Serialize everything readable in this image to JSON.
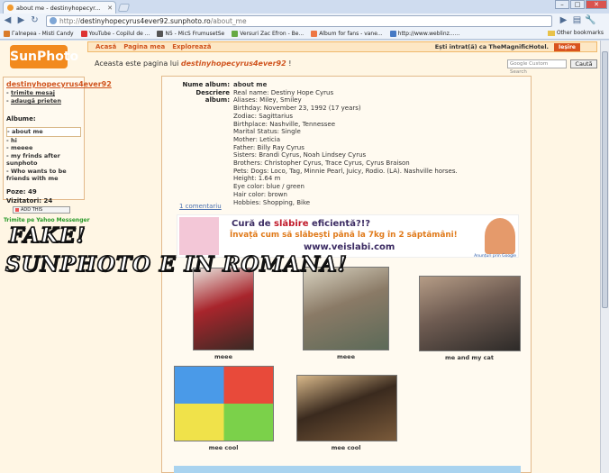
{
  "browser": {
    "tab_title": "about me - destinyhopecyr...",
    "url_prefix": "http://",
    "url_host": "destinyhopecyrus4ever92.sunphoto.ro",
    "url_path": "/about_me",
    "other_bookmarks": "Other bookmarks",
    "bookmarks": [
      {
        "label": "Гalnepea - Misti Candy",
        "color": "#d97b2a"
      },
      {
        "label": "YouTube - Copilul de ...",
        "color": "#d33"
      },
      {
        "label": "N5 - MicS FrumusetSe",
        "color": "#555"
      },
      {
        "label": "Versuri Zac Efron - Be...",
        "color": "#6a4"
      },
      {
        "label": "Album for fans - vane...",
        "color": "#e74"
      },
      {
        "label": "http://www.weblinz......",
        "color": "#4679c4"
      }
    ]
  },
  "site": {
    "logo": "SunPhoto",
    "nav": [
      "Acasă",
      "Pagina mea",
      "Explorează"
    ],
    "logged_in_text": "Ești intrat(ă) ca TheMagnificHotel.",
    "logout_label": "Ieșire",
    "page_intro": "Aceasta este pagina lui",
    "page_owner": "destinyhopecyrus4ever92",
    "page_suffix": " !",
    "search_placeholder": "Google Custom Search",
    "search_button": "Caută"
  },
  "sidebar": {
    "username": "destinyhopecyrus4ever92",
    "send_message": "trimite mesaj",
    "add_friend": "adaugă prieten",
    "albums_heading": "Albume:",
    "albums": [
      "about me",
      "hi",
      "meeee",
      "my frinds after sunphoto",
      "Who wants to be friends with me"
    ],
    "photos_label": "Poze:",
    "photos_count": "49",
    "visitors_label": "Vizitatori:",
    "visitors_count": "24",
    "addthis": "ADD THIS",
    "yahoo": "Trimite pe Yahoo Messenger"
  },
  "overlay": {
    "line1": "FAKE!",
    "line2": "SUNPHOTO E IN ROMANA!"
  },
  "album": {
    "name_label": "Nume album:",
    "name_value": "about me",
    "desc_label": "Descriere album:",
    "desc_lines": [
      "Real name: Destiny Hope Cyrus",
      "Aliases: Miley, Smiley",
      "Birthday: November 23, 1992 (17 years)",
      "Zodiac: Sagittarius",
      "Birthplace: Nashville, Tennessee",
      "Marital Status: Single",
      "Mother: Leticia",
      "Father: Billy Ray Cyrus",
      "Sisters: Brandi Cyrus, Noah Lindsey Cyrus",
      "Brothers: Christopher Cyrus, Trace Cyrus, Cyrus Braison",
      "Pets: Dogs: Loco, Tag, Minnie Pearl, Juicy, Rodio. (LA). Nashville horses.",
      "Height: 1.64 m",
      "Eye color: blue / green",
      "Hair color: brown",
      "Hobbies: Shopping, Bike"
    ],
    "comments": "1 comentariu"
  },
  "ad": {
    "line1_a": "Cură de ",
    "line1_b": "slăbire",
    "line1_c": " eficientă?!?",
    "line2": "Învață cum să slăbești până la 7kg în 2 săptămâni!",
    "line3": "www.veislabi.com",
    "google": "Anunțuri prin Google"
  },
  "photos": [
    {
      "caption": "meee",
      "colors": [
        "#3a2a24",
        "#e8e2dc",
        "#a8252c"
      ]
    },
    {
      "caption": "meee",
      "colors": [
        "#5c6a58",
        "#d8d2c0",
        "#8a7a66"
      ]
    },
    {
      "caption": "me and my cat",
      "colors": [
        "#2d2a28",
        "#b59c86",
        "#6f5c52"
      ]
    },
    {
      "caption": "mee cool",
      "colors": [
        "#e84a3a",
        "#7bd14a",
        "#f0e24a"
      ]
    },
    {
      "caption": "mee cool",
      "colors": [
        "#7a5a3a",
        "#d8b88a",
        "#3a2a1e"
      ]
    }
  ]
}
